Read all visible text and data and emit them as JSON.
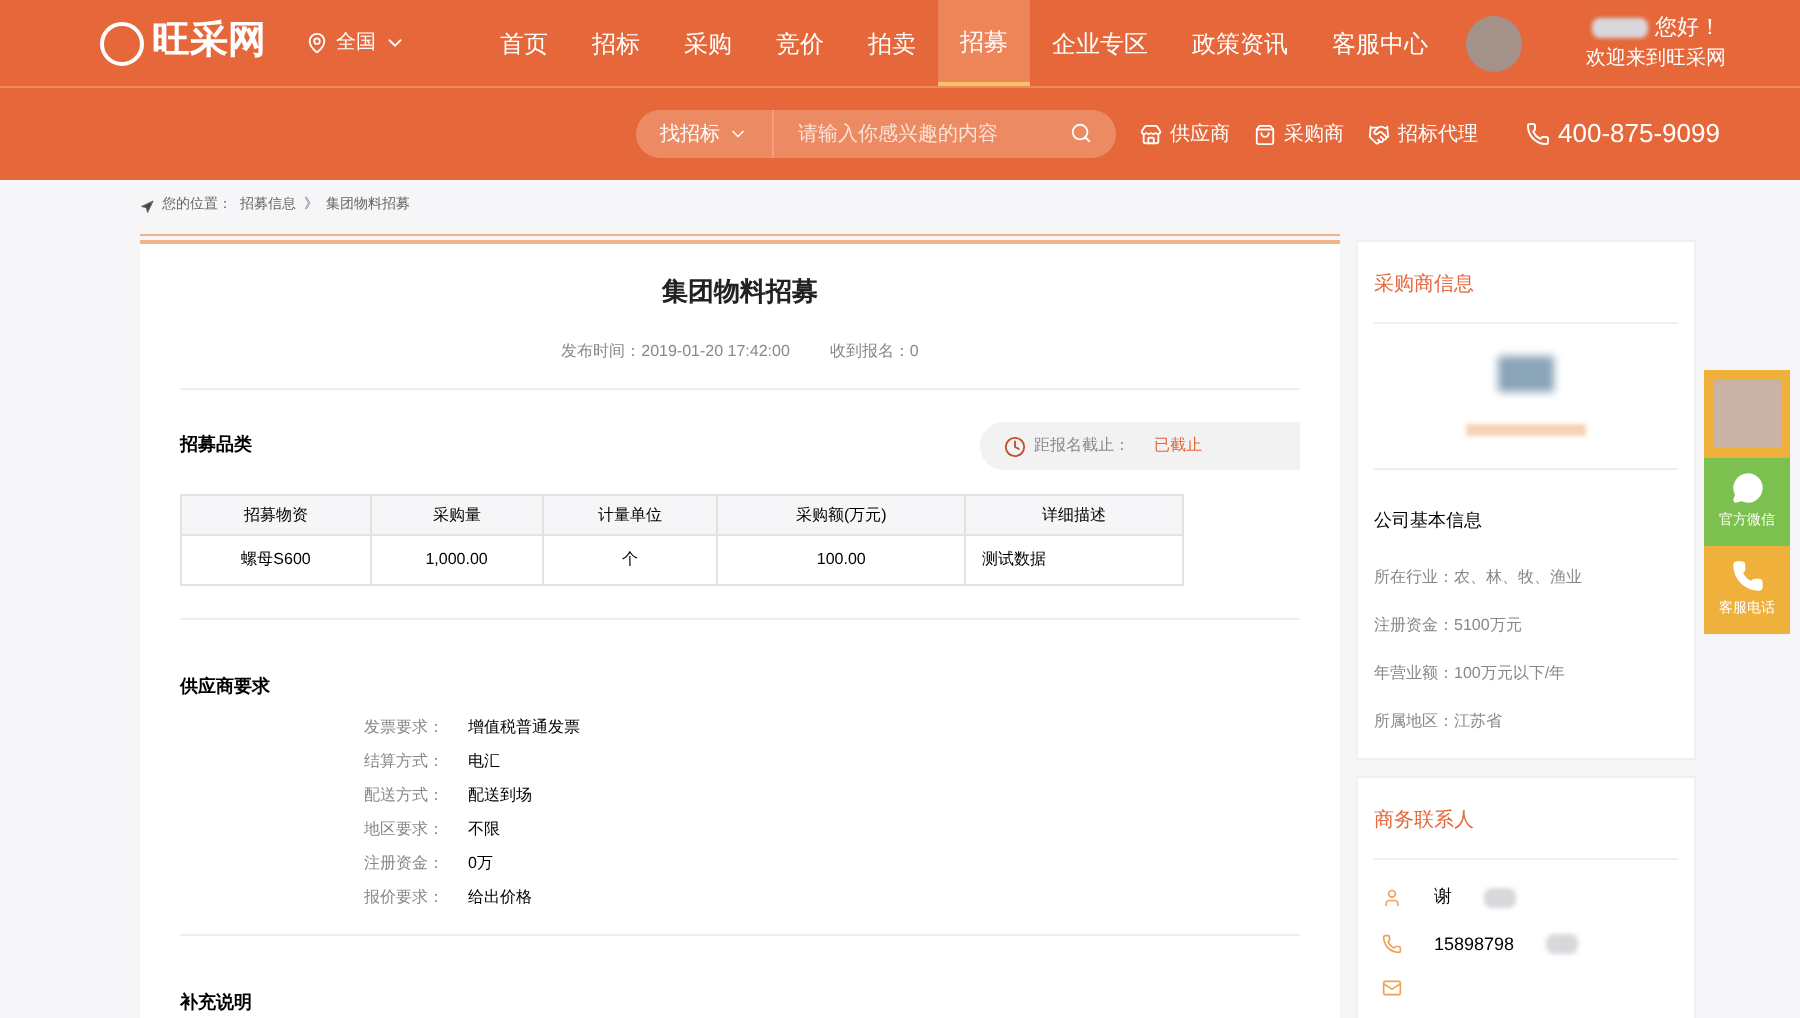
{
  "header": {
    "logo": "旺采网",
    "location": "全国",
    "nav": [
      {
        "label": "首页",
        "selected": false
      },
      {
        "label": "招标",
        "selected": false
      },
      {
        "label": "采购",
        "selected": false
      },
      {
        "label": "竞价",
        "selected": false
      },
      {
        "label": "拍卖",
        "selected": false
      },
      {
        "label": "招募",
        "selected": true
      },
      {
        "label": "企业专区",
        "selected": false
      },
      {
        "label": "政策资讯",
        "selected": false
      },
      {
        "label": "客服中心",
        "selected": false
      }
    ],
    "greeting": "您好！",
    "welcome": "欢迎来到旺采网"
  },
  "search": {
    "category": "找招标",
    "placeholder": "请输入你感兴趣的内容"
  },
  "quick_links": [
    {
      "kind": "supplier",
      "label": "供应商"
    },
    {
      "kind": "buyer",
      "label": "采购商"
    },
    {
      "kind": "agent",
      "label": "招标代理"
    }
  ],
  "hotline": "400-875-9099",
  "breadcrumb": {
    "prefix": "您的位置：",
    "items": [
      "招募信息",
      "集团物料招募"
    ],
    "separator": "》"
  },
  "article": {
    "title": "集团物料招募",
    "published": "发布时间：2019-01-20 17:42:00",
    "signups": "收到报名：0",
    "section_title": "招募品类",
    "deadline_label": "距报名截止：",
    "deadline_status": "已截止",
    "table": {
      "columns": [
        "招募物资",
        "采购量",
        "计量单位",
        "采购额(万元)",
        "详细描述"
      ],
      "rows": [
        [
          "螺母S600",
          "1,000.00",
          "个",
          "100.00",
          "测试数据"
        ]
      ]
    },
    "requirements_title": "供应商要求",
    "requirements": [
      {
        "label": "发票要求：",
        "value": "增值税普通发票"
      },
      {
        "label": "结算方式：",
        "value": "电汇"
      },
      {
        "label": "配送方式：",
        "value": "配送到场"
      },
      {
        "label": "地区要求：",
        "value": "不限"
      },
      {
        "label": "注册资金：",
        "value": "0万"
      },
      {
        "label": "报价要求：",
        "value": "给出价格"
      }
    ],
    "notes_title": "补充说明"
  },
  "buyer": {
    "title": "采购商信息",
    "basic_title": "公司基本信息",
    "facts": [
      "所在行业：农、林、牧、渔业",
      "注册资金：5100万元",
      "年营业额：100万元以下/年",
      "所属地区：江苏省"
    ]
  },
  "contact": {
    "title": "商务联系人",
    "items": [
      {
        "kind": "person",
        "value": "谢"
      },
      {
        "kind": "phone",
        "value": "15898798"
      },
      {
        "kind": "mail",
        "value": ""
      }
    ]
  },
  "float_bar": [
    {
      "kind": "avatar"
    },
    {
      "kind": "wechat",
      "label": "官方微信",
      "color": "#7cc04f"
    },
    {
      "kind": "phone",
      "label": "客服电话",
      "color": "#f0b03c"
    }
  ]
}
